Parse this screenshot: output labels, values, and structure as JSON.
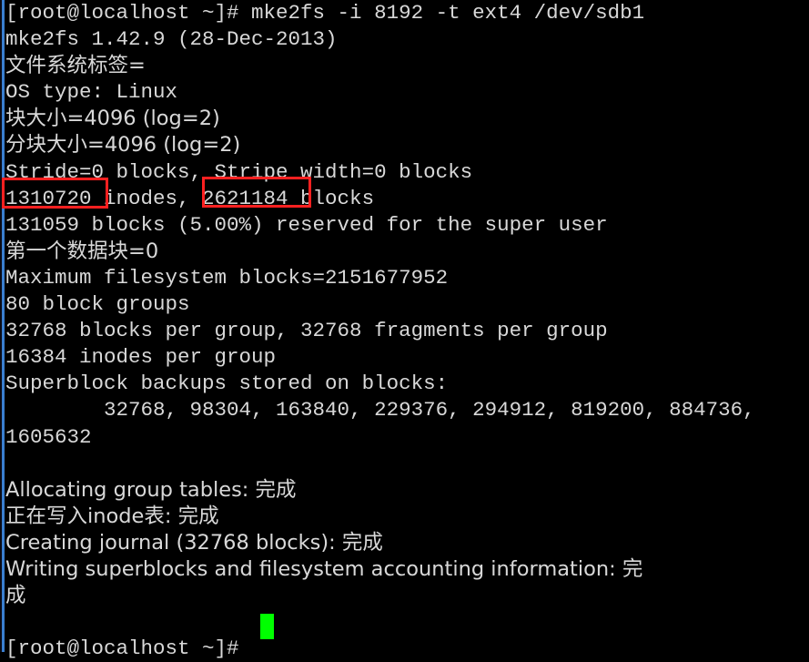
{
  "terminal": {
    "title": "root@localhost terminal",
    "background_color": "#000000",
    "text_color": "#d8d8d8",
    "cursor_color": "#00ff00",
    "highlight_color": "#ff2020",
    "edge_color": "#3a7fd0",
    "prompt": "[root@localhost ~]#",
    "command": "mke2fs -i 8192 -t ext4 /dev/sdb1",
    "command_line": "[root@localhost ~]# mke2fs -i 8192 -t ext4 /dev/sdb1",
    "output": [
      "mke2fs 1.42.9 (28-Dec-2013)",
      "文件系统标签=",
      "OS type: Linux",
      "块大小=4096 (log=2)",
      "分块大小=4096 (log=2)",
      "Stride=0 blocks, Stripe width=0 blocks",
      "1310720 inodes, 2621184 blocks",
      "131059 blocks (5.00%) reserved for the super user",
      "第一个数据块=0",
      "Maximum filesystem blocks=2151677952",
      "80 block groups",
      "32768 blocks per group, 32768 fragments per group",
      "16384 inodes per group",
      "Superblock backups stored on blocks:",
      "        32768, 98304, 163840, 229376, 294912, 819200, 884736,",
      "1605632",
      "",
      "Allocating group tables: 完成",
      "正在写入inode表: 完成",
      "Creating journal (32768 blocks): 完成",
      "Writing superblocks and filesystem accounting information: 完",
      "成",
      ""
    ],
    "final_prompt": "[root@localhost ~]# ",
    "highlights": [
      {
        "name": "inodes-count",
        "value": "1310720"
      },
      {
        "name": "blocks-count",
        "value": "2621184"
      }
    ]
  }
}
